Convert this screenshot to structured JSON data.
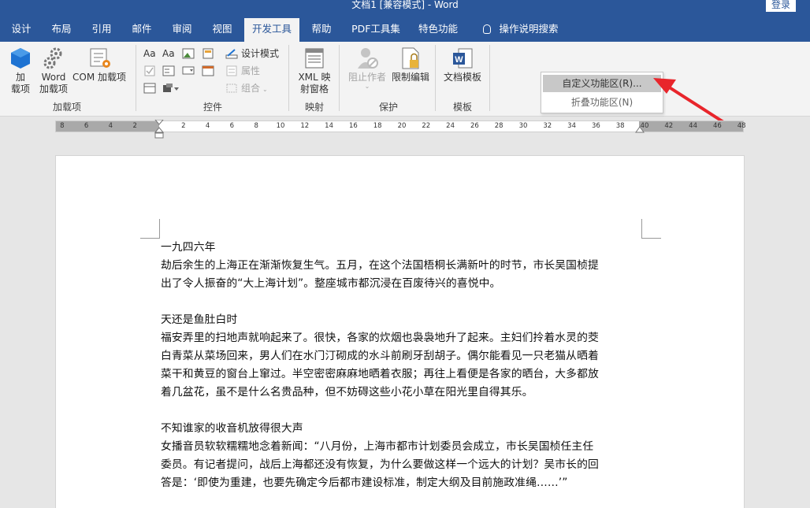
{
  "window": {
    "title": "文档1 [兼容模式] - Word",
    "login_label": "登录"
  },
  "tabs": [
    {
      "label": "设计"
    },
    {
      "label": "布局"
    },
    {
      "label": "引用"
    },
    {
      "label": "邮件"
    },
    {
      "label": "审阅"
    },
    {
      "label": "视图"
    },
    {
      "label": "开发工具",
      "active": true
    },
    {
      "label": "帮助"
    },
    {
      "label": "PDF工具集"
    },
    {
      "label": "特色功能"
    },
    {
      "label": "操作说明搜索",
      "icon": "lightbulb-icon"
    }
  ],
  "ribbon": {
    "addins": {
      "group_label": "加载项",
      "addins_btn": "加\n载项",
      "word_addins_btn": "Word\n加载项",
      "com_addins_btn": "COM 加载项"
    },
    "controls": {
      "group_label": "控件",
      "design_mode": "设计模式",
      "properties": "属性",
      "group": "组合"
    },
    "mapping": {
      "group_label": "映射",
      "xml_pane": "XML 映\n射窗格"
    },
    "protect": {
      "group_label": "保护",
      "block_authors": "阻止作者",
      "restrict_editing": "限制编辑"
    },
    "templates": {
      "group_label": "模板",
      "doc_template": "文档模板"
    }
  },
  "context_menu": {
    "items": [
      {
        "label": "自定义功能区(R)...",
        "underline": "R"
      },
      {
        "label": "折叠功能区(N)",
        "underline": "N"
      }
    ]
  },
  "ruler": {
    "labels": [
      "8",
      "6",
      "4",
      "2",
      "2",
      "4",
      "6",
      "8",
      "10",
      "12",
      "14",
      "16",
      "18",
      "20",
      "22",
      "24",
      "26",
      "28",
      "30",
      "32",
      "34",
      "36",
      "38",
      "40",
      "42",
      "44",
      "46",
      "48"
    ]
  },
  "document": {
    "paragraphs": [
      "一九四六年",
      "劫后余生的上海正在渐渐恢复生气。五月，在这个法国梧桐长满新叶的时节，市长吴国桢提",
      "出了令人振奋的“大上海计划”。整座城市都沉浸在百废待兴的喜悦中。",
      "",
      "天还是鱼肚白时",
      "福安弄里的扫地声就响起来了。很快，各家的炊烟也袅袅地升了起来。主妇们拎着水灵的茭",
      "白青菜从菜场回来，男人们在水门汀砌成的水斗前刷牙刮胡子。偶尔能看见一只老猫从晒着",
      "菜干和黄豆的窗台上窜过。半空密密麻麻地晒着衣服；再往上看便是各家的晒台，大多都放",
      "着几盆花，虽不是什么名贵品种，但不妨碍这些小花小草在阳光里自得其乐。",
      "",
      "不知谁家的收音机放得很大声",
      "女播音员软软糯糯地念着新闻：“八月份，上海市都市计划委员会成立，市长吴国桢任主任",
      "委员。有记者提问，战后上海都还没有恢复，为什么要做这样一个远大的计划？吴市长的回",
      "答是：‘即使为重建，也要先确定今后都市建设标准，制定大纲及目前施政准绳……’”"
    ]
  },
  "colors": {
    "brand": "#2b579a",
    "ribbon_bg": "#f3f3f3",
    "canvas_bg": "#e6e6e6",
    "annotation_arrow": "#e8252b"
  }
}
